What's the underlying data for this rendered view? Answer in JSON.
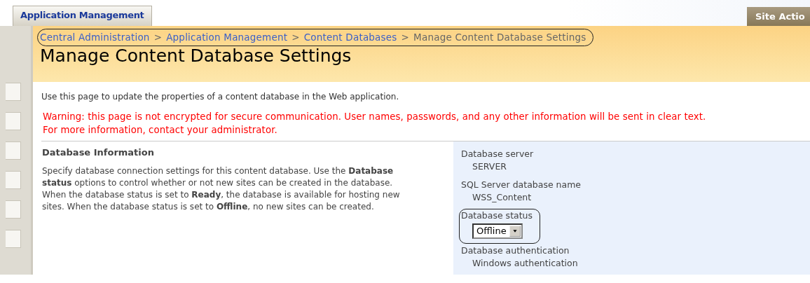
{
  "top_tabs": [
    {
      "label": "Application Management",
      "selected": true
    }
  ],
  "site_actions": {
    "label": "Site Actio"
  },
  "breadcrumb": {
    "highlighted": true,
    "items": [
      {
        "label": "Central Administration",
        "kind": "link"
      },
      {
        "label": "Application Management",
        "kind": "link"
      },
      {
        "label": "Content Databases",
        "kind": "link"
      },
      {
        "label": "Manage Content Database Settings",
        "kind": "current"
      }
    ],
    "separator": ">"
  },
  "page_title": "Manage Content Database Settings",
  "intro": "Use this page to update the properties of a content database in the Web application.",
  "warning_lines": [
    "Warning: this page is not encrypted for secure communication. User names, passwords, and any other information will be sent in clear text.",
    "For more information, contact your administrator."
  ],
  "section": {
    "title": "Database Information",
    "description": "Specify database connection settings for this content database. Use the **Database status** options to control whether or not new sites can be created in the database. When the database status is set to **Ready**, the database is available for hosting new sites. When the database status is set to **Offline**, no new sites can be created."
  },
  "fields": [
    {
      "label": "Database server",
      "value": "SERVER",
      "kind": "text",
      "highlighted": false
    },
    {
      "label": "SQL Server database name",
      "value": "WSS_Content",
      "kind": "text",
      "highlighted": false
    },
    {
      "label": "Database status",
      "value": "Offline",
      "kind": "select",
      "highlighted": true
    },
    {
      "label": "Database authentication",
      "value": "Windows authentication",
      "kind": "text",
      "highlighted": false
    }
  ]
}
